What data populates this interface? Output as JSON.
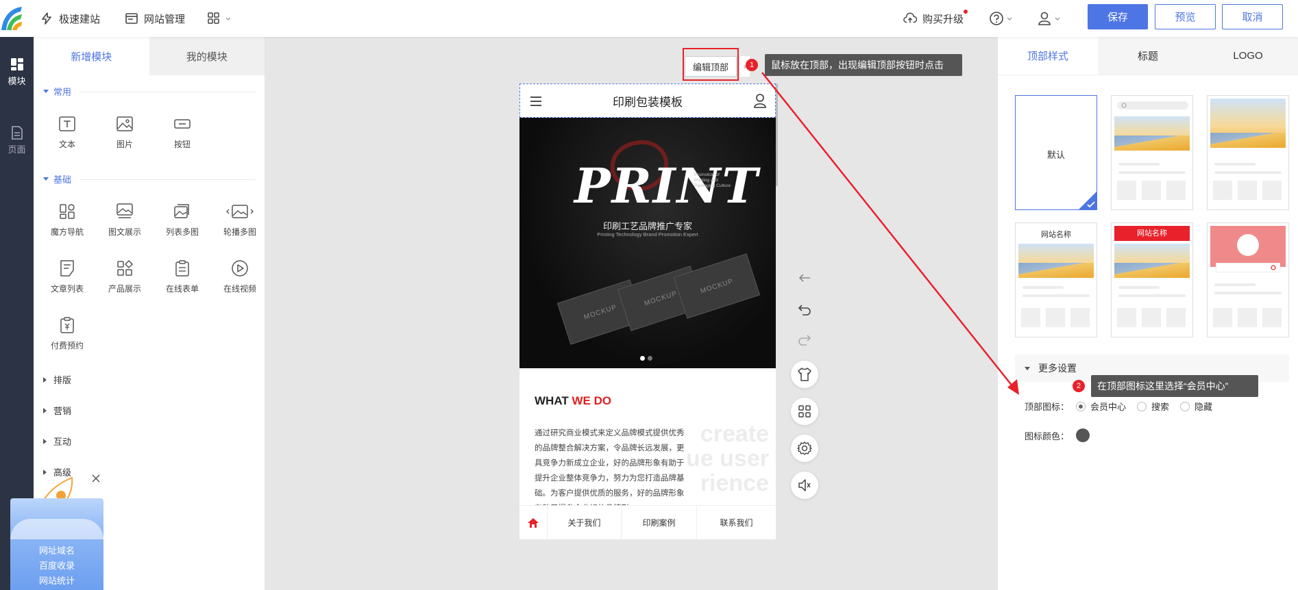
{
  "topbar": {
    "quick_build": "极速建站",
    "site_manage": "网站管理",
    "upgrade": "购买升级",
    "save": "保存",
    "preview": "预览",
    "cancel": "取消"
  },
  "rail": {
    "items": [
      {
        "label": "模块"
      },
      {
        "label": "页面"
      }
    ]
  },
  "left_panel": {
    "tabs": [
      "新增模块",
      "我的模块"
    ],
    "sections": {
      "common": {
        "title": "常用",
        "items": [
          "文本",
          "图片",
          "按钮"
        ]
      },
      "basic": {
        "title": "基础",
        "items": [
          "魔方导航",
          "图文展示",
          "列表多图",
          "轮播多图",
          "文章列表",
          "产品展示",
          "在线表单",
          "在线视频",
          "付费预约"
        ]
      },
      "collapsed": [
        "排版",
        "营销",
        "互动",
        "高级"
      ]
    },
    "promo": [
      "网址域名",
      "百度收录",
      "网站统计"
    ]
  },
  "canvas": {
    "edit_top_button": "编辑顶部",
    "tip1_num": "1",
    "tip1_text": "鼠标放在顶部，出现编辑顶部按钮时点击",
    "tip2_num": "2",
    "tip2_text": "在顶部图标这里选择“会员中心”",
    "phone": {
      "title": "印刷包装模板",
      "banner_word": "PRINT",
      "banner_sub_cn": "印刷工艺品牌推广专家",
      "banner_sub_en": "Printing Technology Brand Promotion Expert",
      "banner_side": "Promotion of Printing and Packaging Culture",
      "card_text": "MOCKUP",
      "what_a": "WHAT",
      "what_b": "WE DO",
      "paragraph": "通过研究商业模式来定义品牌模式提供优秀的品牌整合解决方案，令品牌长远发展，更具竞争力新成立企业，好的品牌形象有助于提升企业整体竞争力，努力为您打造品牌基础。为客户提供优质的服务，好的品牌形象有助于提升企业好的品牌形",
      "watermark": [
        "create",
        "ue user",
        "rience"
      ],
      "footer": [
        "关于我们",
        "印刷案例",
        "联系我们"
      ]
    }
  },
  "right_panel": {
    "tabs": [
      "顶部样式",
      "标题",
      "LOGO"
    ],
    "styles": [
      {
        "label": "默认"
      },
      {
        "label": ""
      },
      {
        "label": ""
      },
      {
        "label": "网站名称"
      },
      {
        "label": "网站名称"
      },
      {
        "label": ""
      }
    ],
    "more_settings": "更多设置",
    "top_icon_label": "顶部图标：",
    "top_icon_options": [
      "会员中心",
      "搜索",
      "隐藏"
    ],
    "top_icon_selected": "会员中心",
    "icon_color_label": "图标颜色：",
    "icon_color": "#555555"
  },
  "colors": {
    "accent": "#4d75e3",
    "rail": "#2c3344",
    "red": "#e8212b"
  }
}
